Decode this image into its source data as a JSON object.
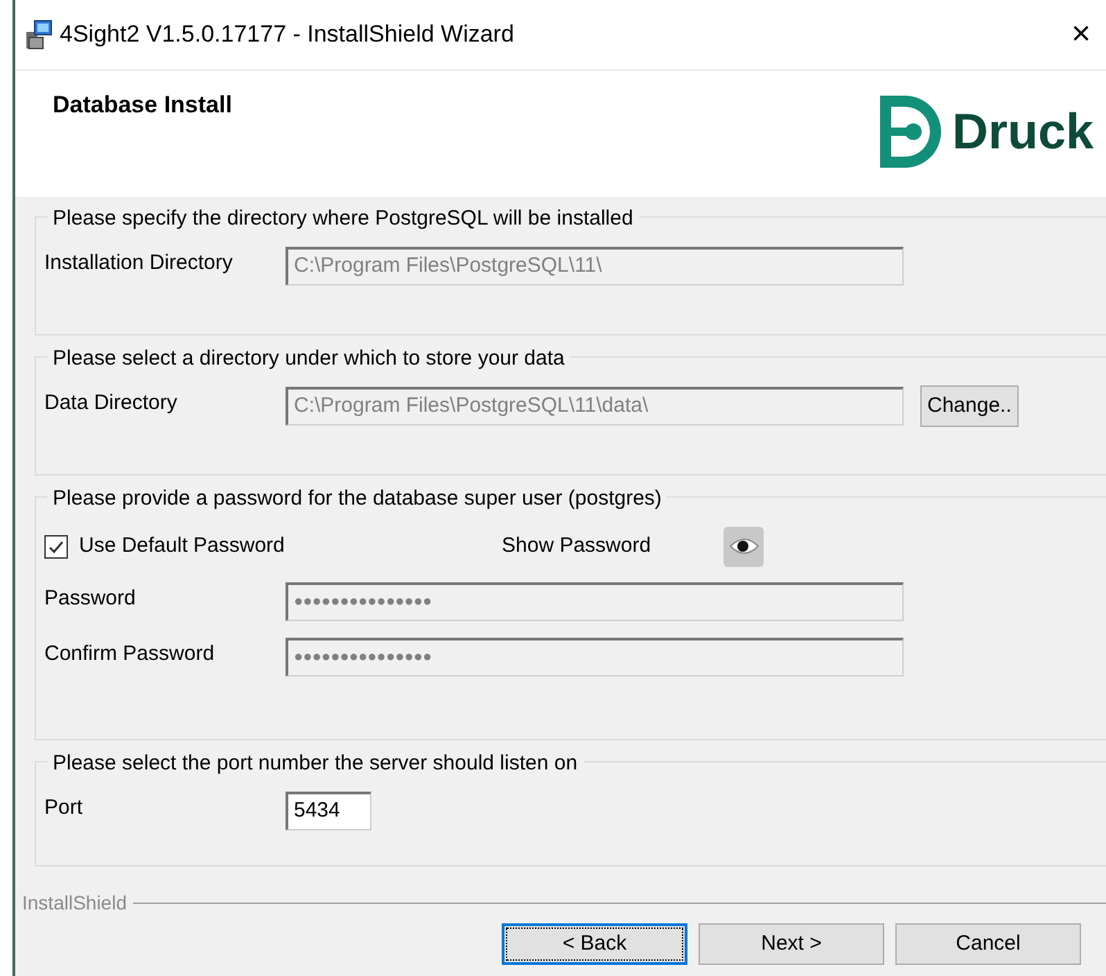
{
  "window": {
    "title": "4Sight2 V1.5.0.17177 - InstallShield Wizard",
    "close": "×"
  },
  "header": {
    "title": "Database Install",
    "logo_text": "Druck"
  },
  "groups": [
    {
      "legend": "Please specify the directory where PostgreSQL will be installed",
      "rows": [
        {
          "kind": "field",
          "label": "Installation Directory",
          "value": "C:\\Program Files\\PostgreSQL\\11\\",
          "disabled": true
        }
      ]
    },
    {
      "legend": "Please select a directory under which to store your data",
      "rows": [
        {
          "kind": "field",
          "label": "Data Directory",
          "value": "C:\\Program Files\\PostgreSQL\\11\\data\\",
          "disabled": true,
          "button": "Change.."
        }
      ]
    },
    {
      "legend": "Please provide a password for the database super user (postgres)",
      "rows": [
        {
          "kind": "checkbox",
          "label": "Use Default Password",
          "checked": true,
          "toggle_label": "Show Password"
        },
        {
          "kind": "field",
          "label": "Password",
          "value": "●●●●●●●●●●●●●●●",
          "disabled": true
        },
        {
          "kind": "field",
          "label": "Confirm Password",
          "value": "●●●●●●●●●●●●●●●",
          "disabled": true
        }
      ]
    },
    {
      "legend": "Please select the port number the server should listen on",
      "rows": [
        {
          "kind": "port",
          "label": "Port",
          "value": "5434",
          "disabled": false
        }
      ]
    }
  ],
  "footer": {
    "brand": "InstallShield",
    "buttons": [
      {
        "label": "< Back",
        "focused": true
      },
      {
        "label": "Next >",
        "focused": false
      },
      {
        "label": "Cancel",
        "focused": false
      }
    ]
  }
}
